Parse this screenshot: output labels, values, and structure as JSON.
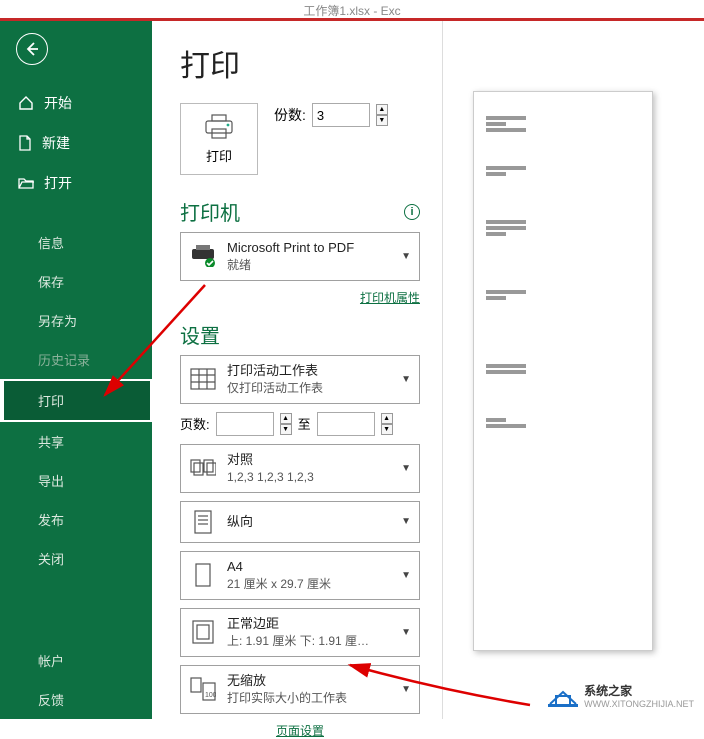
{
  "titlebar": "工作簿1.xlsx  -  Exc",
  "sidebar": {
    "home": "开始",
    "new": "新建",
    "open": "打开",
    "info": "信息",
    "save": "保存",
    "saveas": "另存为",
    "history": "历史记录",
    "print": "打印",
    "share": "共享",
    "export": "导出",
    "publish": "发布",
    "close": "关闭",
    "account": "帐户",
    "feedback": "反馈"
  },
  "page": {
    "title": "打印",
    "print_button": "打印",
    "copies_label": "份数:",
    "copies_value": "3"
  },
  "printer": {
    "section": "打印机",
    "name": "Microsoft Print to PDF",
    "status": "就绪",
    "properties_link": "打印机属性"
  },
  "settings": {
    "section": "设置",
    "what": {
      "title": "打印活动工作表",
      "sub": "仅打印活动工作表"
    },
    "pages_label": "页数:",
    "pages_to": "至",
    "collate": {
      "title": "对照",
      "sub": "1,2,3    1,2,3    1,2,3"
    },
    "orient": {
      "title": "纵向",
      "sub": ""
    },
    "paper": {
      "title": "A4",
      "sub": "21 厘米 x 29.7 厘米"
    },
    "margin": {
      "title": "正常边距",
      "sub": "上: 1.91 厘米 下: 1.91 厘…"
    },
    "scale": {
      "title": "无缩放",
      "sub": "打印实际大小的工作表"
    },
    "page_setup_link": "页面设置"
  },
  "watermark": {
    "name": "系统之家",
    "url": "WWW.XITONGZHIJIA.NET"
  }
}
